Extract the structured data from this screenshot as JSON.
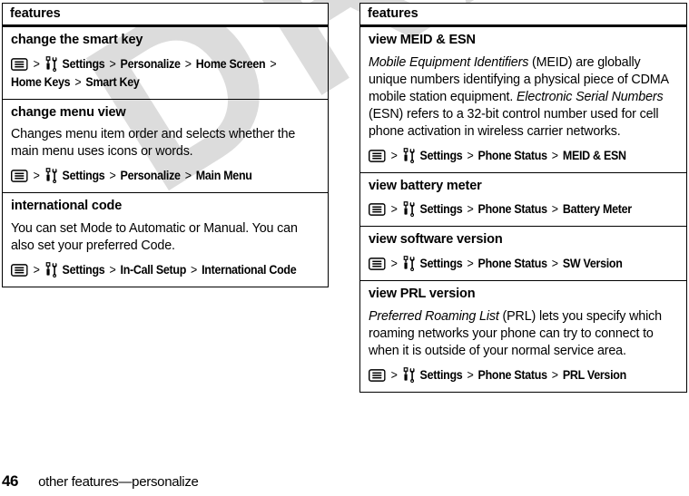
{
  "document": {
    "watermark": "DRAFT",
    "watermark_color": "#dcdcdc",
    "page_number": "46",
    "footer_title": "other features—personalize"
  },
  "icons": {
    "menu_key": "menu-key-icon",
    "settings": "settings-tools-icon",
    "separator": ">"
  },
  "left_table": {
    "header": "features",
    "rows": [
      {
        "title": "change the smart key",
        "description": "",
        "path": [
          "Settings",
          "Personalize",
          "Home Screen",
          "Home Keys",
          "Smart Key"
        ]
      },
      {
        "title": "change menu view",
        "description": "Changes menu item order and selects whether the main menu uses icons or words.",
        "path": [
          "Settings",
          "Personalize",
          "Main Menu"
        ]
      },
      {
        "title": "international code",
        "description": "You can set Mode to Automatic or Manual. You can also set your preferred Code.",
        "path": [
          "Settings",
          "In-Call Setup",
          "International Code"
        ]
      }
    ]
  },
  "right_table": {
    "header": "features",
    "rows": [
      {
        "title": "view MEID & ESN",
        "description_html": "<em>Mobile Equipment Identifiers</em> (MEID) are globally unique numbers identifying a physical piece of CDMA mobile station equipment. <em>Electronic Serial Numbers</em> (ESN) refers to a 32-bit control number used for cell phone activation in wireless carrier networks.",
        "path": [
          "Settings",
          "Phone Status",
          "MEID & ESN"
        ]
      },
      {
        "title": "view battery meter",
        "description_html": "",
        "path": [
          "Settings",
          "Phone Status",
          "Battery Meter"
        ]
      },
      {
        "title": "view software version",
        "description_html": "",
        "path": [
          "Settings",
          "Phone Status",
          "SW Version"
        ]
      },
      {
        "title": "view PRL version",
        "description_html": "<em>Preferred Roaming List</em> (PRL) lets you specify which roaming networks your phone can try to connect to when it is outside of your normal service area.",
        "path": [
          "Settings",
          "Phone Status",
          "PRL Version"
        ]
      }
    ]
  }
}
